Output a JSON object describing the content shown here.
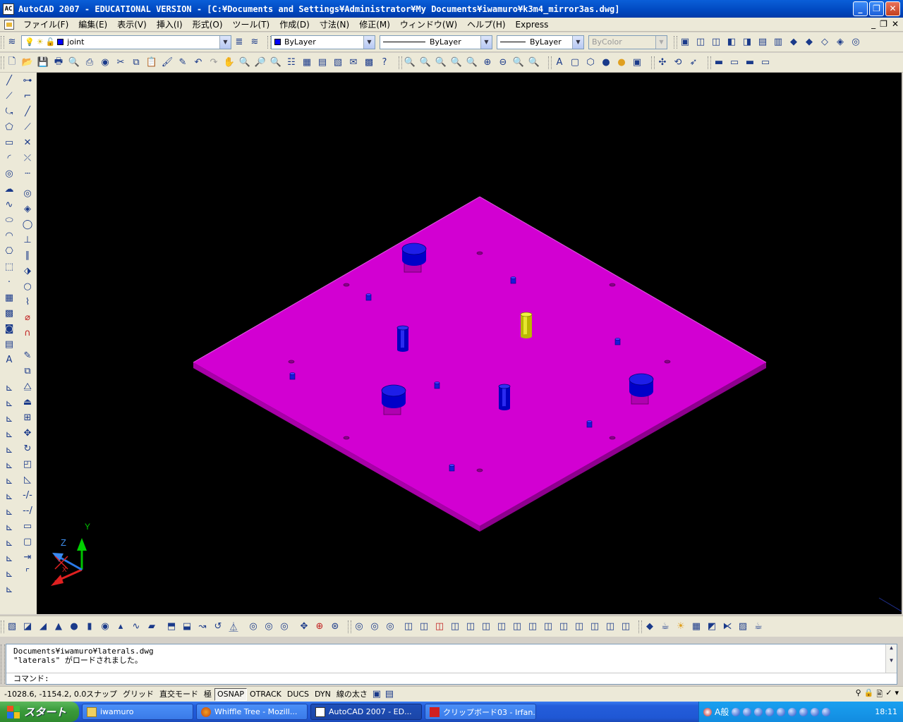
{
  "window": {
    "title": "AutoCAD 2007 - EDUCATIONAL VERSION - [C:¥Documents and Settings¥Administrator¥My Documents¥iwamuro¥k3m4_mirror3as.dwg]",
    "app_icon_text": "AC"
  },
  "menu": {
    "items": [
      "ファイル(F)",
      "編集(E)",
      "表示(V)",
      "挿入(I)",
      "形式(O)",
      "ツール(T)",
      "作成(D)",
      "寸法(N)",
      "修正(M)",
      "ウィンドウ(W)",
      "ヘルプ(H)",
      "Express"
    ]
  },
  "layer_bar": {
    "layer_name": "joint",
    "color": "ByLayer",
    "linetype": "ByLayer",
    "lineweight": "ByLayer",
    "plotstyle": "ByColor"
  },
  "command": {
    "history": [
      "Documents¥iwamuro¥laterals.dwg",
      "\"laterals\" がロードされました。"
    ],
    "prompt": "コマンド:"
  },
  "status": {
    "coords": "-1028.6, -1154.2, 0.0",
    "toggles": [
      {
        "label": "スナップ",
        "on": false
      },
      {
        "label": "グリッド",
        "on": false
      },
      {
        "label": "直交モード",
        "on": false
      },
      {
        "label": "極",
        "on": false
      },
      {
        "label": "OSNAP",
        "on": true
      },
      {
        "label": "OTRACK",
        "on": false
      },
      {
        "label": "DUCS",
        "on": false
      },
      {
        "label": "DYN",
        "on": false
      },
      {
        "label": "線の太さ",
        "on": false
      }
    ]
  },
  "ucs": {
    "x": "X",
    "y": "Y",
    "z": "Z"
  },
  "taskbar": {
    "start_label": "スタート",
    "tasks": [
      {
        "label": "iwamuro",
        "active": false
      },
      {
        "label": "Whiffle Tree - Mozill...",
        "active": false
      },
      {
        "label": "AutoCAD 2007 - ED...",
        "active": true
      },
      {
        "label": "クリップボード03 - Irfan...",
        "active": false
      }
    ],
    "ime_label": "A般",
    "clock": "18:11"
  },
  "colors": {
    "plate_top": "#d100d1",
    "plate_side": "#a500a5",
    "bolt_blue": "#0000cc",
    "pin_yellow": "#cccc00",
    "background": "#000000"
  }
}
